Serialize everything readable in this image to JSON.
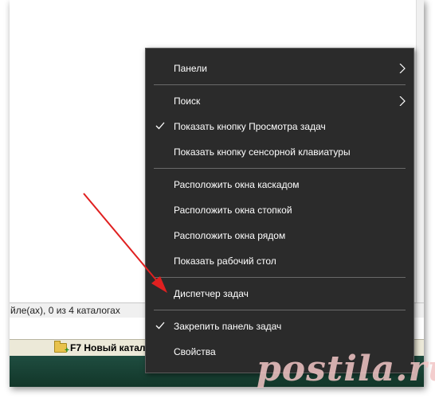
{
  "status_bar": {
    "text": "йле(ах), 0 из 4 каталогах"
  },
  "fkey_bar": {
    "f7_label": "F7 Новый катал"
  },
  "context_menu": {
    "items": [
      {
        "label": "Панели",
        "checked": false,
        "submenu": true
      },
      {
        "label": "Поиск",
        "checked": false,
        "submenu": true
      },
      {
        "label": "Показать кнопку Просмотра задач",
        "checked": true,
        "submenu": false
      },
      {
        "label": "Показать кнопку сенсорной клавиатуры",
        "checked": false,
        "submenu": false
      },
      {
        "label": "Расположить окна каскадом",
        "checked": false,
        "submenu": false
      },
      {
        "label": "Расположить окна стопкой",
        "checked": false,
        "submenu": false
      },
      {
        "label": "Расположить окна рядом",
        "checked": false,
        "submenu": false
      },
      {
        "label": "Показать рабочий стол",
        "checked": false,
        "submenu": false
      },
      {
        "label": "Диспетчер задач",
        "checked": false,
        "submenu": false
      },
      {
        "label": "Закрепить панель задач",
        "checked": true,
        "submenu": false
      },
      {
        "label": "Свойства",
        "checked": false,
        "submenu": false
      }
    ]
  },
  "watermark": {
    "text": "postila.ru"
  },
  "colors": {
    "menu_bg": "#2b2b2b",
    "menu_text": "#ffffff",
    "annotation_arrow": "#e02020",
    "taskbar": "#1a4034"
  },
  "icons": {
    "check": "check-icon",
    "submenu": "chevron-right-icon",
    "folder": "new-folder-icon"
  }
}
